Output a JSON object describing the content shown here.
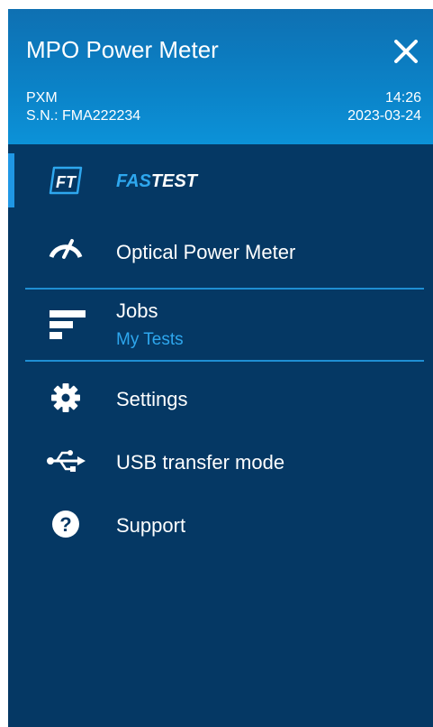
{
  "header": {
    "title": "MPO Power Meter",
    "model": "PXM",
    "serial": "S.N.: FMA222234",
    "time": "14:26",
    "date": "2023-03-24"
  },
  "menu": {
    "fastest": {
      "label_a": "FAS",
      "label_b": "TEST",
      "icon": "ft-icon"
    },
    "optical_power_meter": {
      "label": "Optical Power Meter",
      "icon": "gauge-icon"
    },
    "jobs": {
      "label": "Jobs",
      "sublabel": "My Tests",
      "icon": "jobs-icon"
    },
    "settings": {
      "label": "Settings",
      "icon": "gear-icon"
    },
    "usb": {
      "label": "USB transfer mode",
      "icon": "usb-icon"
    },
    "support": {
      "label": "Support",
      "icon": "help-icon"
    }
  },
  "colors": {
    "panel": "#053864",
    "header": "#0b83c8",
    "accent": "#1f97e5",
    "sublabel": "#2ea7ee"
  }
}
